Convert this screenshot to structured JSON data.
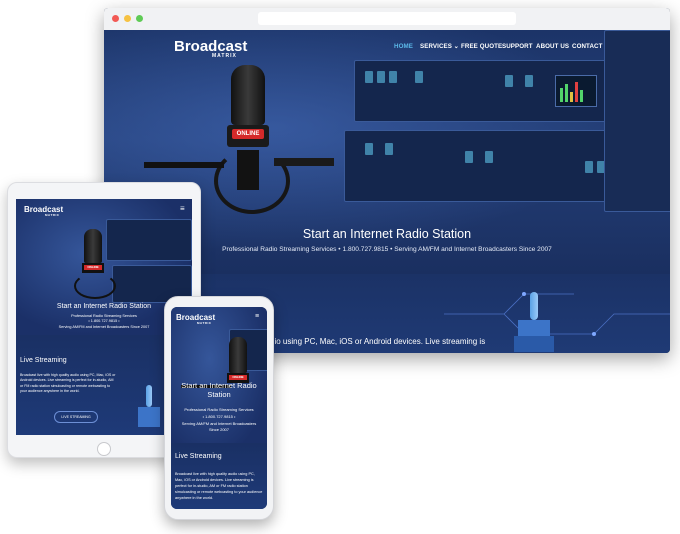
{
  "desktop": {
    "logo_main": "Broadcast",
    "logo_sub": "MATRIX",
    "nav": [
      "HOME",
      "SERVICES ⌄",
      "FREE QUOTE",
      "SUPPORT",
      "ABOUT US",
      "CONTACT"
    ],
    "mic_label": "ONLINE",
    "hero_title": "Start an Internet Radio Station",
    "hero_subtitle": "Professional Radio Streaming Services  •  1.800.727.9815  •  Serving AM/FM and Internet Broadcasters Since 2007",
    "section_text": "dio using PC, Mac, iOS or Android devices. Live streaming is"
  },
  "tablet": {
    "logo_main": "Broadcast",
    "logo_sub": "MATRIX",
    "menu_icon": "≡",
    "mic_label": "ONLINE",
    "hero_title": "Start an Internet Radio Station",
    "hero_line1": "Professional Radio Streaming Services",
    "hero_line2": "• 1.800.727.9815 •",
    "hero_line3": "Serving AM/FM and Internet Broadcasters Since 2007",
    "section_title": "Live Streaming",
    "section_body": "Broadcast live with high quality audio using PC, Mac, iOS or Android devices. Live streaming is perfect for in-studio, AM or FM radio station simulcasting or remote webcasting to your audience anywhere in the world.",
    "button": "LIVE STREAMING"
  },
  "phone": {
    "logo_main": "Broadcast",
    "logo_sub": "MATRIX",
    "menu_icon": "≡",
    "mic_label": "ONLINE",
    "hero_title": "Start an Internet Radio Station",
    "hero_line1": "Professional Radio Streaming Services",
    "hero_line2": "• 1.800.727.9815 •",
    "hero_line3": "Serving AM/FM and Internet Broadcasters Since 2007",
    "section_title": "Live Streaming",
    "section_body": "Broadcast live with high quality audio using PC, Mac, iOS or Android devices. Live streaming is perfect for in-studio, AM or FM radio station simulcasting or remote webcasting to your audience anywhere in the world."
  },
  "colors": {
    "nav_active": "#5bb8e8",
    "mic_red": "#d42a2a",
    "button_border": "#6d8fd6"
  }
}
